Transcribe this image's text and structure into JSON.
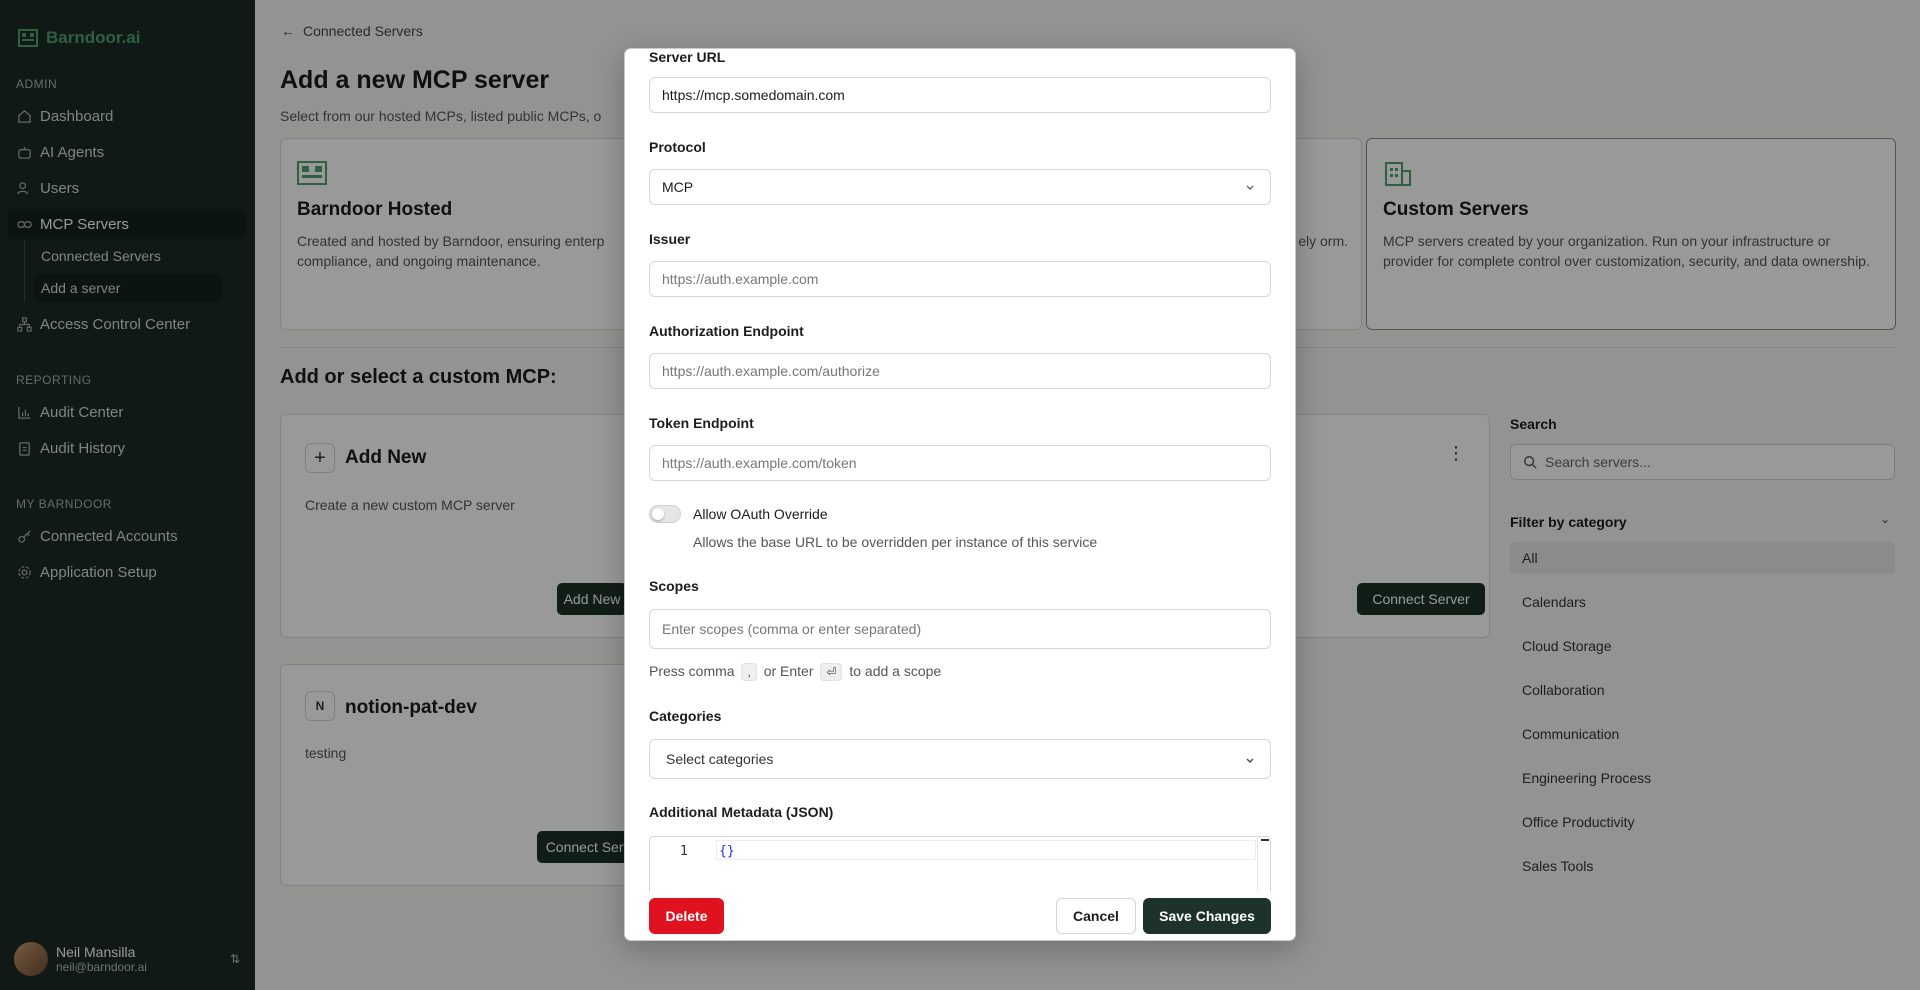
{
  "sidebar": {
    "brand": "Barndoor.ai",
    "sections": {
      "admin": "ADMIN",
      "reporting": "REPORTING",
      "my": "MY BARNDOOR"
    },
    "items": {
      "dashboard": "Dashboard",
      "agents": "AI Agents",
      "users": "Users",
      "mcp": "MCP Servers",
      "connected": "Connected Servers",
      "add": "Add a server",
      "acc": "Access Control Center",
      "audit_center": "Audit Center",
      "audit_history": "Audit History",
      "accounts": "Connected Accounts",
      "setup": "Application Setup"
    },
    "user": {
      "name": "Neil Mansilla",
      "email": "neil@barndoor.ai"
    }
  },
  "main": {
    "breadcrumb": "Connected Servers",
    "title": "Add a new MCP server",
    "subtitle": "Select from our hosted MCPs, listed public MCPs, o",
    "cards": {
      "hosted_title": "Barndoor Hosted",
      "hosted_desc": "Created and hosted by Barndoor, ensuring enterp compliance, and ongoing maintenance.",
      "public_desc_tail": "ely orm.",
      "custom_title": "Custom Servers",
      "custom_desc": "MCP servers created by your organization. Run on your infrastructure or provider for complete control over customization, security, and data ownership."
    },
    "section_title": "Add or select a custom MCP:",
    "add_new": {
      "title": "Add New",
      "desc": "Create a new custom MCP server",
      "button": "Add New"
    },
    "connect_button": "Connect Server",
    "notion": {
      "initial": "N",
      "title": "notion-pat-dev",
      "desc": "testing",
      "button": "Connect Serve"
    },
    "search": {
      "label": "Search",
      "placeholder": "Search servers..."
    },
    "filter": {
      "label": "Filter by category",
      "categories": [
        "All",
        "Calendars",
        "Cloud Storage",
        "Collaboration",
        "Communication",
        "Engineering Process",
        "Office Productivity",
        "Sales Tools"
      ]
    }
  },
  "modal": {
    "server_url": {
      "label": "Server URL",
      "value": "https://mcp.somedomain.com"
    },
    "protocol": {
      "label": "Protocol",
      "value": "MCP"
    },
    "issuer": {
      "label": "Issuer",
      "placeholder": "https://auth.example.com"
    },
    "auth_endpoint": {
      "label": "Authorization Endpoint",
      "placeholder": "https://auth.example.com/authorize"
    },
    "token_endpoint": {
      "label": "Token Endpoint",
      "placeholder": "https://auth.example.com/token"
    },
    "oauth_override": {
      "label": "Allow OAuth Override",
      "help": "Allows the base URL to be overridden per instance of this service",
      "enabled": false
    },
    "scopes": {
      "label": "Scopes",
      "placeholder": "Enter scopes (comma or enter separated)",
      "help_1": "Press comma",
      "key_1": ",",
      "help_2": "or Enter",
      "key_2": "⏎",
      "help_3": "to add a scope"
    },
    "categories": {
      "label": "Categories",
      "placeholder": "Select categories"
    },
    "metadata": {
      "label": "Additional Metadata (JSON)",
      "line": "1",
      "code": "{}"
    },
    "buttons": {
      "delete": "Delete",
      "cancel": "Cancel",
      "save": "Save Changes"
    }
  }
}
